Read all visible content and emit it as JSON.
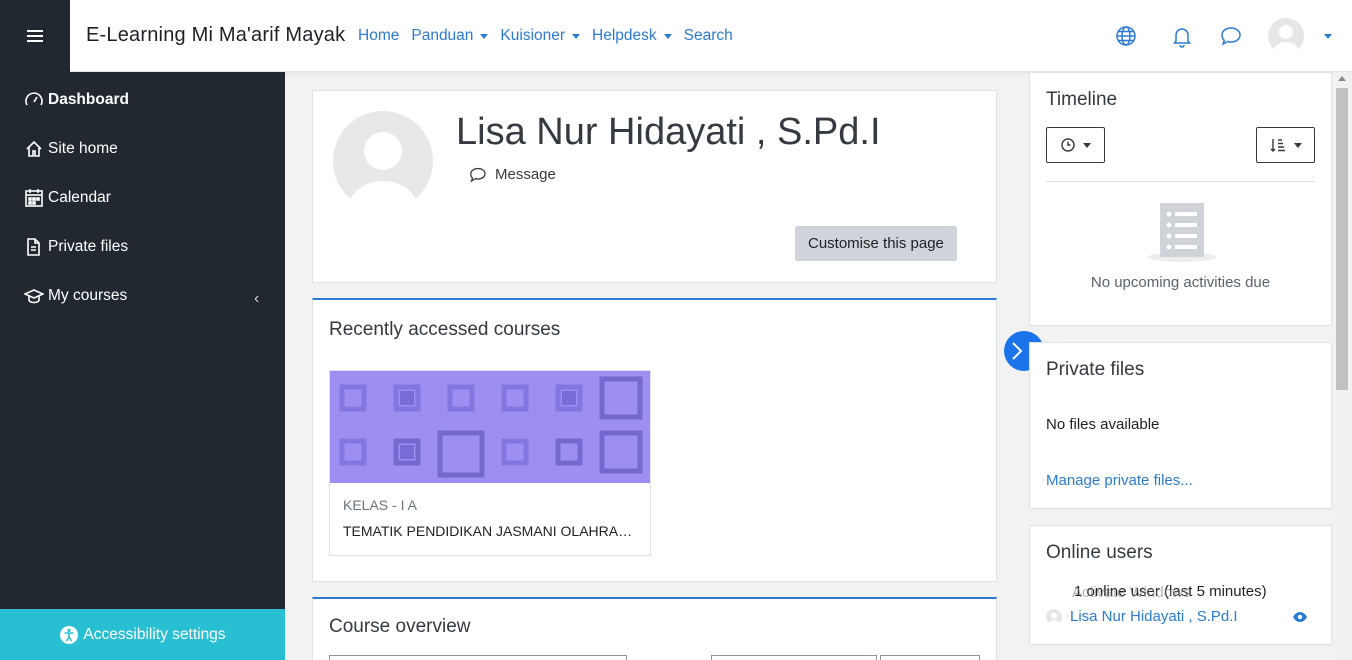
{
  "header": {
    "brand": "E-Learning Mi Ma'arif Mayak",
    "nav": [
      {
        "label": "Home",
        "dropdown": false
      },
      {
        "label": "Panduan",
        "dropdown": true
      },
      {
        "label": "Kuisioner",
        "dropdown": true
      },
      {
        "label": "Helpdesk",
        "dropdown": true
      },
      {
        "label": "Search",
        "dropdown": false
      }
    ],
    "icons": [
      "hamburger-icon",
      "globe-icon",
      "bell-icon",
      "chat-icon",
      "user-avatar"
    ]
  },
  "sidebar": {
    "items": [
      {
        "label": "Dashboard",
        "icon": "dashboard-icon",
        "active": true
      },
      {
        "label": "Site home",
        "icon": "home-icon"
      },
      {
        "label": "Calendar",
        "icon": "calendar-icon"
      },
      {
        "label": "Private files",
        "icon": "files-icon"
      },
      {
        "label": "My courses",
        "icon": "graduation-cap-icon"
      }
    ],
    "accessibility": "Accessibility settings"
  },
  "profile": {
    "name": "Lisa Nur Hidayati , S.Pd.I",
    "message": "Message",
    "customise": "Customise this page"
  },
  "recent": {
    "title": "Recently accessed courses",
    "course": {
      "category": "KELAS - I A",
      "name": "TEMATIK PENDIDIKAN JASMANI OLAHRAGA DAN KESEHATAN",
      "image_color": "#9d8ff2"
    }
  },
  "overview": {
    "title": "Course overview"
  },
  "timeline": {
    "title": "Timeline",
    "empty": "No upcoming activities due"
  },
  "private_files": {
    "title": "Private files",
    "empty": "No files available",
    "manage": "Manage private files..."
  },
  "online_users": {
    "title": "Online users",
    "subtitle": "1 online user (last 5 minutes)",
    "user": "Lisa Nur Hidayati , S.Pd.I"
  },
  "watermark": "Activate Windows",
  "colors": {
    "sidebar_bg": "#22282f",
    "accent": "#2b7bd4",
    "a11y_bar": "#29bfd3"
  }
}
